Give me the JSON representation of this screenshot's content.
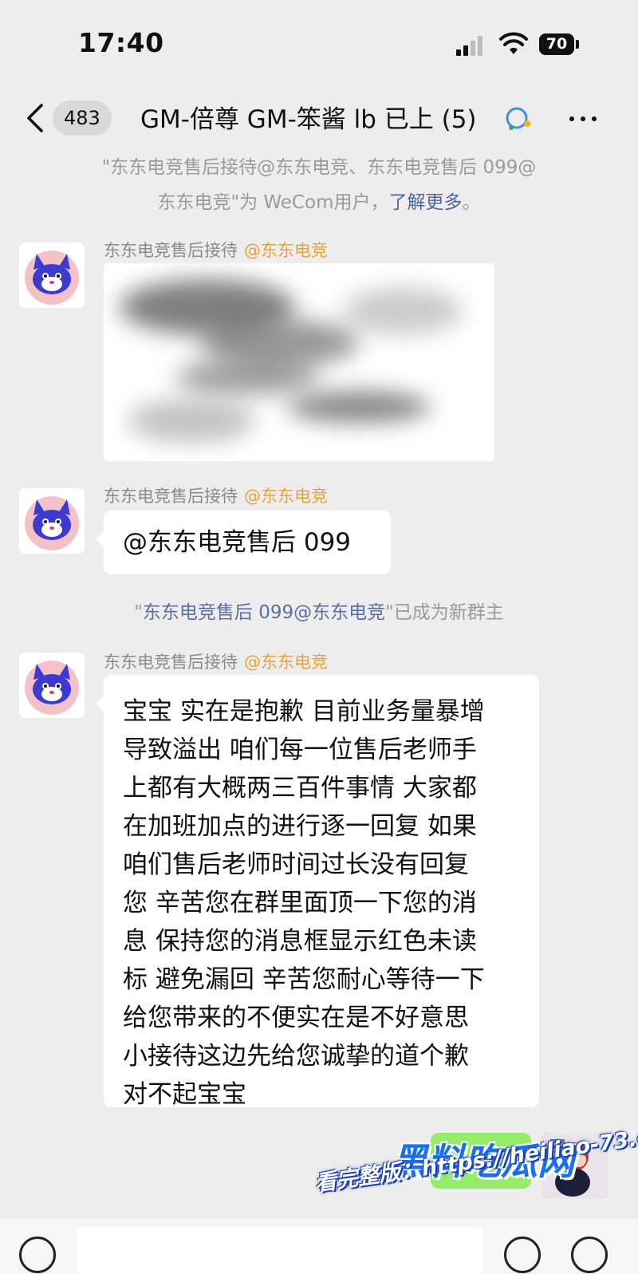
{
  "status_bar": {
    "time": "17:40",
    "battery": "70"
  },
  "header": {
    "unread_count": "483",
    "title": "GM-倍尊 GM-笨酱 lb 已上 (5)"
  },
  "notices": {
    "wecom_prefix": "\"东东电竞售后接待@东东电竞、东东电竞售后 099@",
    "wecom_suffix": "东东电竞\"为 WeCom用户，",
    "learn_more": "了解更多",
    "learn_more_end": "。",
    "owner_q1": "\"",
    "owner_name": "东东电竞售后 099@东东电竞",
    "owner_rest": "\"已成为新群主"
  },
  "messages": [
    {
      "sender": "东东电竞售后接待",
      "org": "@东东电竞"
    },
    {
      "sender": "东东电竞售后接待",
      "org": "@东东电竞",
      "text": "@东东电竞售后 099"
    },
    {
      "sender": "东东电竞售后接待",
      "org": "@东东电竞",
      "text": "宝宝 实在是抱歉 目前业务量暴增\n导致溢出 咱们每一位售后老师手\n上都有大概两三百件事情 大家都\n在加班加点的进行逐一回复 如果\n咱们售后老师时间过长没有回复\n您 辛苦您在群里面顶一下您的消\n息 保持您的消息框显示红色未读\n标 避免漏回 辛苦您耐心等待一下\n给您带来的不便实在是不好意思\n小接待这边先给您诚挚的道个歉\n对不起宝宝"
    }
  ],
  "own_message": {
    "text": "哈喽"
  },
  "watermark": {
    "logo": "黑料吃瓜网",
    "url": "看完整版：https://heiliao-73.com"
  },
  "colors": {
    "background": "#ededed",
    "bubble": "#ffffff",
    "own_bubble": "#95ec69",
    "org_tag": "#e6a23c",
    "link": "#4f6794"
  },
  "icons": {
    "back": "chevron-left-icon",
    "more": "more-dots-icon",
    "title_badge": "wecom-icon",
    "voice": "voice-icon",
    "emoji": "emoji-icon",
    "plus": "plus-icon"
  }
}
